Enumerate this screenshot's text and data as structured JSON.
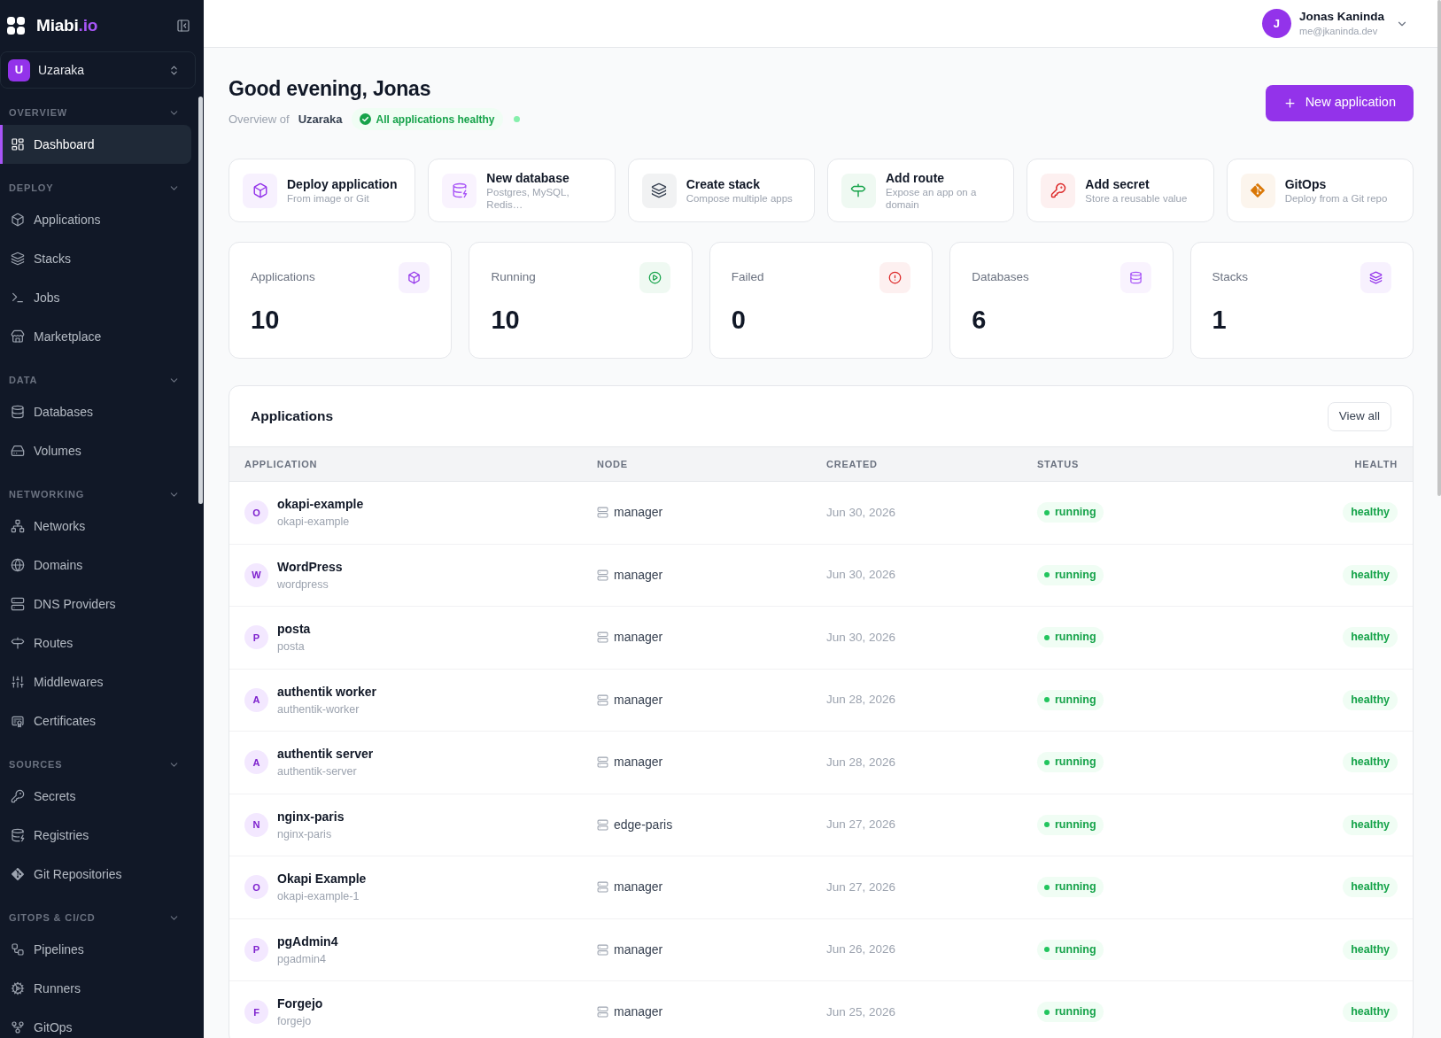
{
  "sidebar": {
    "brand": {
      "name": "Miabi",
      "suffix": ".io"
    },
    "organization": {
      "initial": "U",
      "name": "Uzaraka"
    },
    "sections": [
      {
        "title": "OVERVIEW",
        "expanded": true,
        "items": [
          {
            "label": "Dashboard",
            "selected": true
          }
        ]
      },
      {
        "title": "DEPLOY",
        "expanded": true,
        "items": [
          {
            "label": "Applications",
            "selected": false
          },
          {
            "label": "Stacks",
            "selected": false
          },
          {
            "label": "Jobs",
            "selected": false
          },
          {
            "label": "Marketplace",
            "selected": false
          }
        ]
      },
      {
        "title": "DATA",
        "expanded": true,
        "items": [
          {
            "label": "Databases",
            "selected": false
          },
          {
            "label": "Volumes",
            "selected": false
          }
        ]
      },
      {
        "title": "NETWORKING",
        "expanded": true,
        "items": [
          {
            "label": "Networks",
            "selected": false
          },
          {
            "label": "Domains",
            "selected": false
          },
          {
            "label": "DNS Providers",
            "selected": false
          },
          {
            "label": "Routes",
            "selected": false
          },
          {
            "label": "Middlewares",
            "selected": false
          },
          {
            "label": "Certificates",
            "selected": false
          }
        ]
      },
      {
        "title": "SOURCES",
        "expanded": true,
        "items": [
          {
            "label": "Secrets",
            "selected": false
          },
          {
            "label": "Registries",
            "selected": false
          },
          {
            "label": "Git Repositories",
            "selected": false
          }
        ]
      },
      {
        "title": "GITOPS & CI/CD",
        "expanded": true,
        "items": [
          {
            "label": "Pipelines",
            "selected": false
          },
          {
            "label": "Runners",
            "selected": false
          },
          {
            "label": "GitOps",
            "selected": false
          }
        ]
      }
    ]
  },
  "user": {
    "initial": "J",
    "name": "Jonas Kaninda",
    "email": "me@jkaninda.dev"
  },
  "greeting": {
    "title": "Good evening, Jonas",
    "overview_label": "Overview of",
    "organization": "Uzaraka",
    "health_badge": "All applications healthy"
  },
  "new_application_button": "New application",
  "quick_actions": [
    {
      "title": "Deploy application",
      "description": "From image or Git",
      "color": "#9333ea"
    },
    {
      "title": "New database",
      "description": "Postgres, MySQL, Redis…",
      "color": "#a855f7"
    },
    {
      "title": "Create stack",
      "description": "Compose multiple apps",
      "color": "#374151"
    },
    {
      "title": "Add route",
      "description": "Expose an app on a domain",
      "color": "#16a34a"
    },
    {
      "title": "Add secret",
      "description": "Store a reusable value",
      "color": "#dc2626"
    },
    {
      "title": "GitOps",
      "description": "Deploy from a Git repo",
      "color": "#d97706"
    }
  ],
  "stats": [
    {
      "label": "Applications",
      "value": "10",
      "color": "#9333ea"
    },
    {
      "label": "Running",
      "value": "10",
      "color": "#16a34a"
    },
    {
      "label": "Failed",
      "value": "0",
      "color": "#dc2626"
    },
    {
      "label": "Databases",
      "value": "6",
      "color": "#a855f7"
    },
    {
      "label": "Stacks",
      "value": "1",
      "color": "#9333ea"
    }
  ],
  "applications": {
    "title": "Applications",
    "view_all": "View all",
    "columns": [
      "APPLICATION",
      "NODE",
      "CREATED",
      "STATUS",
      "HEALTH"
    ],
    "rows": [
      {
        "initial": "O",
        "name": "okapi-example",
        "slug": "okapi-example",
        "node": "manager",
        "created": "Jun 30, 2026",
        "status": "running",
        "health": "healthy"
      },
      {
        "initial": "W",
        "name": "WordPress",
        "slug": "wordpress",
        "node": "manager",
        "created": "Jun 30, 2026",
        "status": "running",
        "health": "healthy"
      },
      {
        "initial": "P",
        "name": "posta",
        "slug": "posta",
        "node": "manager",
        "created": "Jun 30, 2026",
        "status": "running",
        "health": "healthy"
      },
      {
        "initial": "A",
        "name": "authentik worker",
        "slug": "authentik-worker",
        "node": "manager",
        "created": "Jun 28, 2026",
        "status": "running",
        "health": "healthy"
      },
      {
        "initial": "A",
        "name": "authentik server",
        "slug": "authentik-server",
        "node": "manager",
        "created": "Jun 28, 2026",
        "status": "running",
        "health": "healthy"
      },
      {
        "initial": "N",
        "name": "nginx-paris",
        "slug": "nginx-paris",
        "node": "edge-paris",
        "created": "Jun 27, 2026",
        "status": "running",
        "health": "healthy"
      },
      {
        "initial": "O",
        "name": "Okapi Example",
        "slug": "okapi-example-1",
        "node": "manager",
        "created": "Jun 27, 2026",
        "status": "running",
        "health": "healthy"
      },
      {
        "initial": "P",
        "name": "pgAdmin4",
        "slug": "pgadmin4",
        "node": "manager",
        "created": "Jun 26, 2026",
        "status": "running",
        "health": "healthy"
      },
      {
        "initial": "F",
        "name": "Forgejo",
        "slug": "forgejo",
        "node": "manager",
        "created": "Jun 25, 2026",
        "status": "running",
        "health": "healthy"
      }
    ]
  }
}
